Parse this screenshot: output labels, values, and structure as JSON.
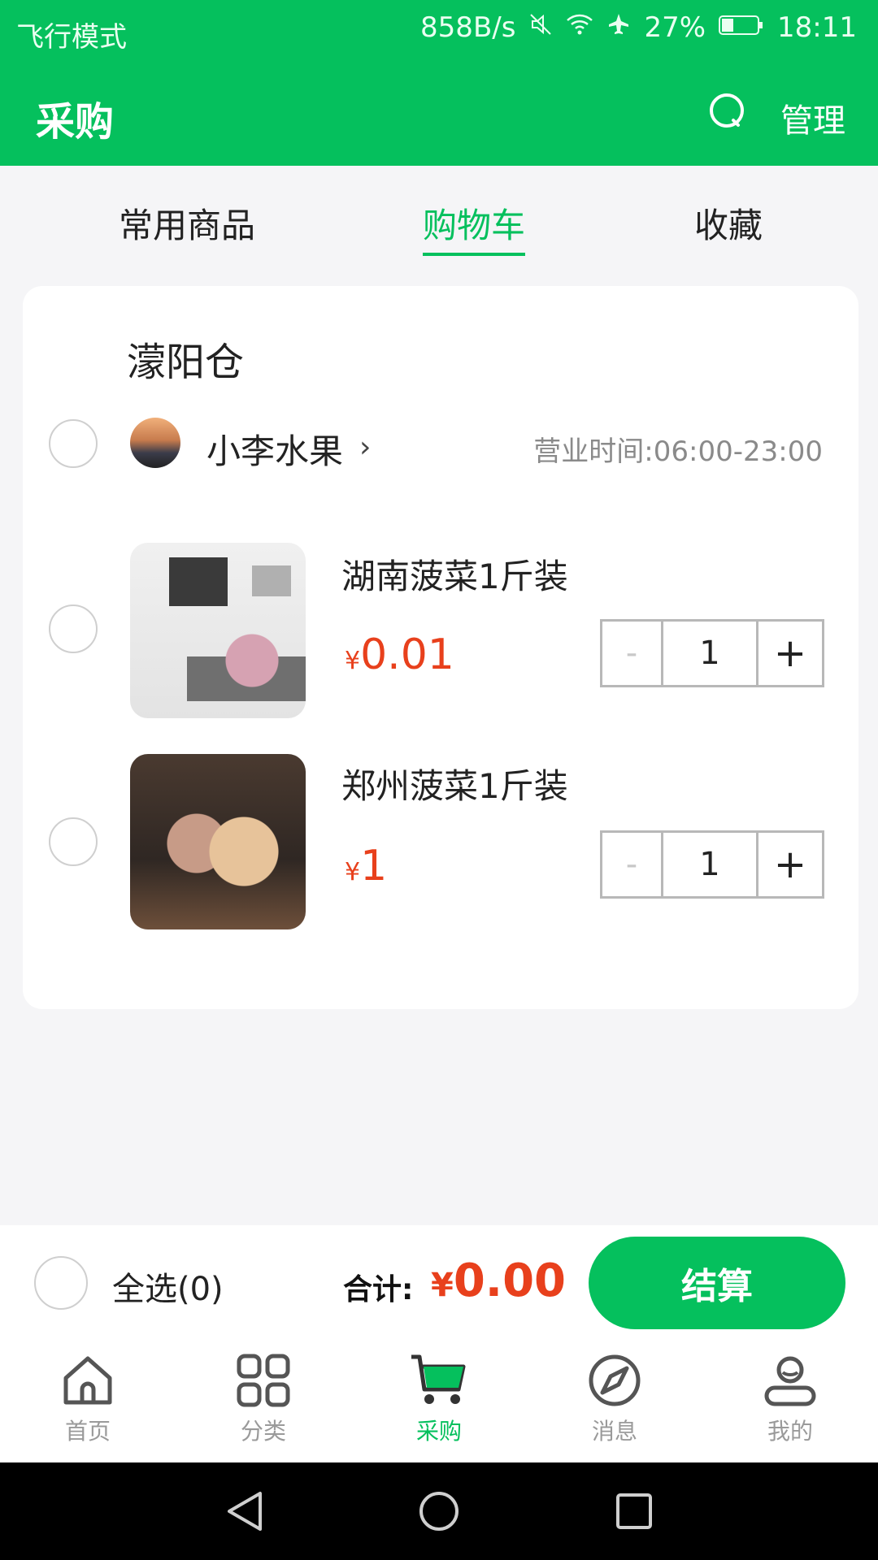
{
  "status_bar": {
    "mode": "飞行模式",
    "speed": "858B/s",
    "battery": "27%",
    "time": "18:11"
  },
  "header": {
    "title": "采购",
    "manage_label": "管理"
  },
  "tabs": [
    {
      "label": "常用商品",
      "active": false
    },
    {
      "label": "购物车",
      "active": true
    },
    {
      "label": "收藏",
      "active": false
    }
  ],
  "cart": {
    "warehouse": "濛阳仓",
    "shop": {
      "name": "小李水果",
      "hours": "营业时间:06:00-23:00"
    },
    "items": [
      {
        "name": "湖南菠菜1斤装",
        "currency": "¥",
        "price": "0.01",
        "qty": "1"
      },
      {
        "name": "郑州菠菜1斤装",
        "currency": "¥",
        "price": "1",
        "qty": "1"
      }
    ]
  },
  "checkout": {
    "select_all": "全选(0)",
    "total_label": "合计:",
    "currency": "¥",
    "total": "0.00",
    "button": "结算"
  },
  "bottom_nav": [
    {
      "label": "首页",
      "icon": "home-icon"
    },
    {
      "label": "分类",
      "icon": "grid-icon"
    },
    {
      "label": "采购",
      "icon": "cart-icon",
      "active": true
    },
    {
      "label": "消息",
      "icon": "compass-icon"
    },
    {
      "label": "我的",
      "icon": "profile-icon"
    }
  ],
  "colors": {
    "brand": "#05c05d",
    "price": "#e8401c"
  }
}
